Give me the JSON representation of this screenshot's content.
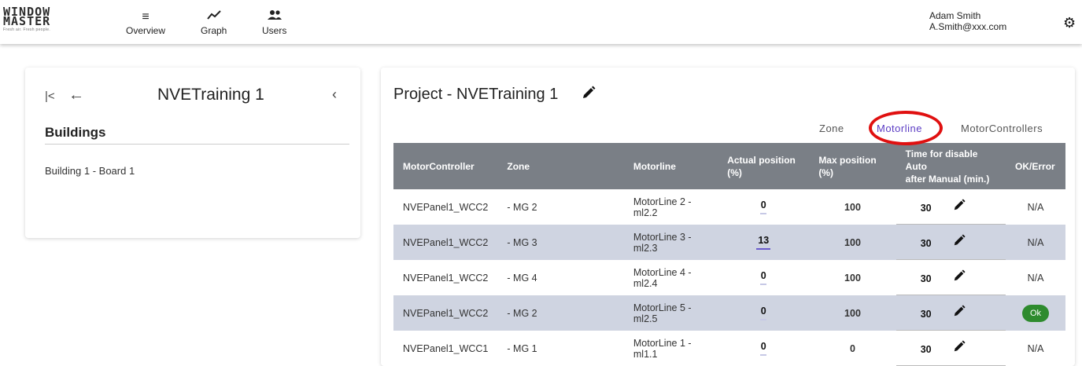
{
  "header": {
    "logo": {
      "line1": "WINDOW",
      "line2": "MASTER",
      "tagline": "Fresh air. Fresh people."
    },
    "nav": [
      {
        "label": "Overview",
        "icon": "menu-icon"
      },
      {
        "label": "Graph",
        "icon": "trending-icon"
      },
      {
        "label": "Users",
        "icon": "users-icon"
      }
    ],
    "user": {
      "name": "Adam Smith",
      "email": "A.Smith@xxx.com"
    }
  },
  "left_panel": {
    "title": "NVETraining 1",
    "section": "Buildings",
    "buildings": [
      "Building 1 - Board 1"
    ]
  },
  "project": {
    "title": "Project - NVETraining 1",
    "tabs": [
      {
        "label": "Zone",
        "active": false
      },
      {
        "label": "Motorline",
        "active": true
      },
      {
        "label": "MotorControllers",
        "active": false
      }
    ],
    "columns": {
      "motorcontroller": "MotorController",
      "zone": "Zone",
      "motorline": "Motorline",
      "actual_position": "Actual position (%)",
      "max_position": "Max position (%)",
      "time_line1": "Time for disable",
      "time_line2": "Auto",
      "time_line3": "after Manual (min.)",
      "ok_error": "OK/Error"
    },
    "rows": [
      {
        "controller": "NVEPanel1_WCC2",
        "zone": "- MG 2",
        "motorline": "MotorLine 2 - ml2.2",
        "actual": "0",
        "max": "100",
        "time": "30",
        "status": "N/A"
      },
      {
        "controller": "NVEPanel1_WCC2",
        "zone": "- MG 3",
        "motorline": "MotorLine 3 - ml2.3",
        "actual": "13",
        "max": "100",
        "time": "30",
        "status": "N/A"
      },
      {
        "controller": "NVEPanel1_WCC2",
        "zone": "- MG 4",
        "motorline": "MotorLine 4 - ml2.4",
        "actual": "0",
        "max": "100",
        "time": "30",
        "status": "N/A"
      },
      {
        "controller": "NVEPanel1_WCC2",
        "zone": "- MG 2",
        "motorline": "MotorLine 5 - ml2.5",
        "actual": "0",
        "max": "100",
        "time": "30",
        "status": "Ok"
      },
      {
        "controller": "NVEPanel1_WCC1",
        "zone": "- MG 1",
        "motorline": "MotorLine 1 - ml1.1",
        "actual": "0",
        "max": "0",
        "time": "30",
        "status": "N/A"
      }
    ]
  },
  "colors": {
    "accent": "#5b3cc4",
    "header_bg": "#7a7f86",
    "alt_row": "#cfd4e1",
    "ok": "#2e8b2e",
    "highlight": "#e01010"
  }
}
